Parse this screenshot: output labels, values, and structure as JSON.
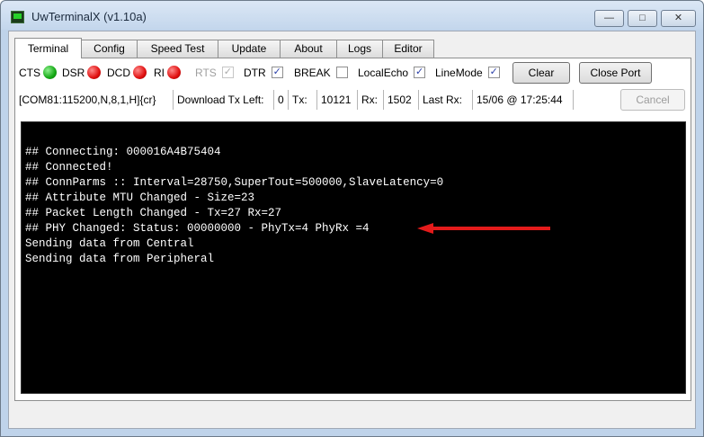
{
  "window": {
    "title": "UwTerminalX (v1.10a)",
    "buttons": {
      "minimize": "—",
      "maximize": "□",
      "close": "✕"
    }
  },
  "tabs": [
    {
      "label": "Terminal",
      "active": true
    },
    {
      "label": "Config"
    },
    {
      "label": "Speed Test"
    },
    {
      "label": "Update"
    },
    {
      "label": "About"
    },
    {
      "label": "Logs"
    },
    {
      "label": "Editor"
    }
  ],
  "signals": {
    "cts": {
      "label": "CTS",
      "state": "green"
    },
    "dsr": {
      "label": "DSR",
      "state": "red"
    },
    "dcd": {
      "label": "DCD",
      "state": "red"
    },
    "ri": {
      "label": "RI",
      "state": "red"
    }
  },
  "checks": {
    "rts": {
      "label": "RTS",
      "checked": true,
      "disabled": true
    },
    "dtr": {
      "label": "DTR",
      "checked": true
    },
    "break": {
      "label": "BREAK",
      "checked": false
    },
    "localecho": {
      "label": "LocalEcho",
      "checked": true
    },
    "linemode": {
      "label": "LineMode",
      "checked": true
    }
  },
  "buttons": {
    "clear": "Clear",
    "close_port": "Close Port",
    "cancel": "Cancel"
  },
  "status": {
    "port": "[COM81:115200,N,8,1,H]{cr}",
    "download_label": "Download Tx Left:",
    "download_value": "0",
    "tx_label": "Tx:",
    "tx_value": "10121",
    "rx_label": "Rx:",
    "rx_value": "1502",
    "lastrx_label": "Last Rx:",
    "lastrx_value": "15/06 @ 17:25:44"
  },
  "terminal": {
    "lines": [
      "## Connecting: 000016A4B75404",
      "## Connected!",
      "## ConnParms :: Interval=28750,SuperTout=500000,SlaveLatency=0",
      "## Attribute MTU Changed - Size=23",
      "## Packet Length Changed - Tx=27 Rx=27",
      "## PHY Changed: Status: 00000000 - PhyTx=4 PhyRx =4",
      "Sending data from Central",
      "Sending data from Peripheral"
    ],
    "annotation_color": "#e41b1b"
  },
  "colors": {
    "terminal_bg": "#000000",
    "terminal_fg": "#ffffff"
  }
}
